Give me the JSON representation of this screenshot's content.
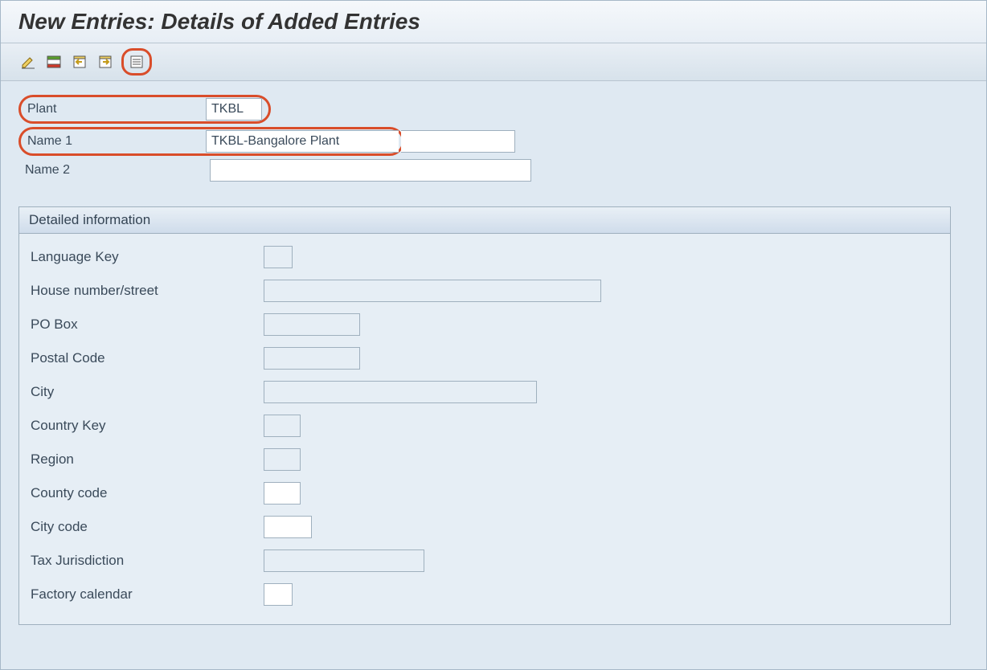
{
  "page_title": "New Entries: Details of Added Entries",
  "toolbar": {
    "icons": [
      "edit-icon",
      "delete-row-icon",
      "previous-entry-icon",
      "next-entry-icon",
      "table-view-icon"
    ]
  },
  "header": {
    "plant_label": "Plant",
    "plant_value": "TKBL",
    "name1_label": "Name 1",
    "name1_value": "TKBL-Bangalore Plant",
    "name2_label": "Name 2",
    "name2_value": ""
  },
  "detail": {
    "group_title": "Detailed information",
    "language_key_label": "Language Key",
    "language_key_value": "",
    "house_street_label": "House number/street",
    "house_street_value": "",
    "po_box_label": "PO Box",
    "po_box_value": "",
    "postal_code_label": "Postal Code",
    "postal_code_value": "",
    "city_label": "City",
    "city_value": "",
    "country_key_label": "Country Key",
    "country_key_value": "",
    "region_label": "Region",
    "region_value": "",
    "county_code_label": "County code",
    "county_code_value": "",
    "city_code_label": "City code",
    "city_code_value": "",
    "tax_jurisdiction_label": "Tax Jurisdiction",
    "tax_jurisdiction_value": "",
    "factory_calendar_label": "Factory calendar",
    "factory_calendar_value": ""
  }
}
